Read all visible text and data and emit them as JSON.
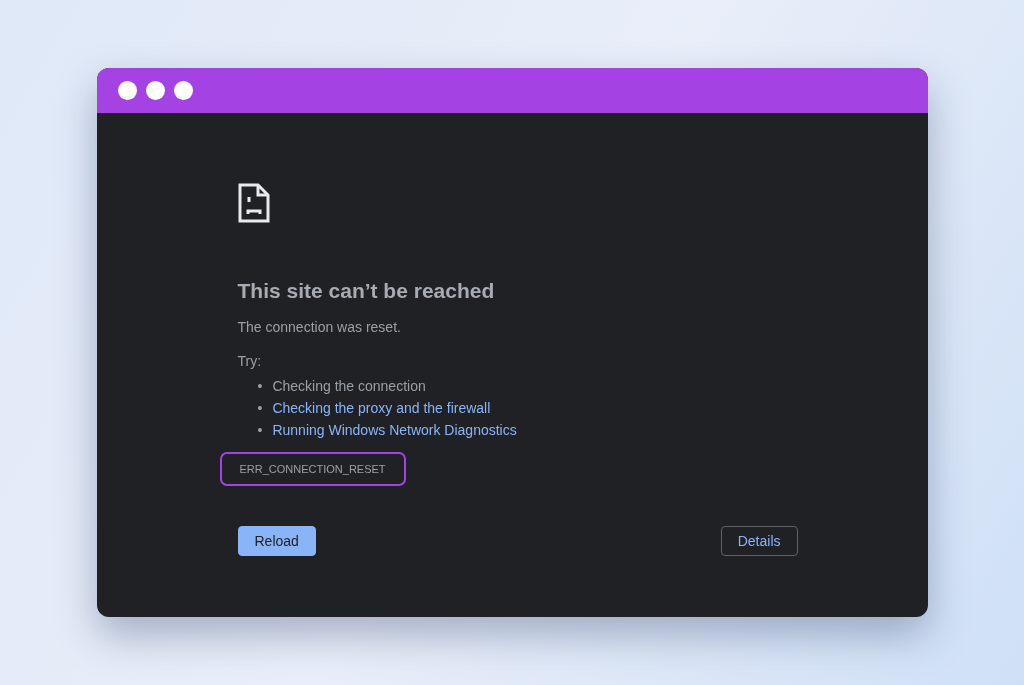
{
  "error": {
    "title": "This site can’t be reached",
    "message": "The connection was reset.",
    "try_label": "Try:",
    "suggestions": [
      {
        "kind": "text",
        "bullet": "•",
        "text": "Checking the connection"
      },
      {
        "kind": "link",
        "bullet": "•",
        "text": "Checking the proxy and the firewall"
      },
      {
        "kind": "link",
        "bullet": "•",
        "text": "Running Windows Network Diagnostics"
      }
    ],
    "code": {
      "text": "ERR_CONNECTION_RESET",
      "highlighted": true
    }
  },
  "buttons": [
    {
      "kind": "primary",
      "label": "Reload"
    },
    {
      "kind": "outline",
      "label": "Details"
    }
  ]
}
